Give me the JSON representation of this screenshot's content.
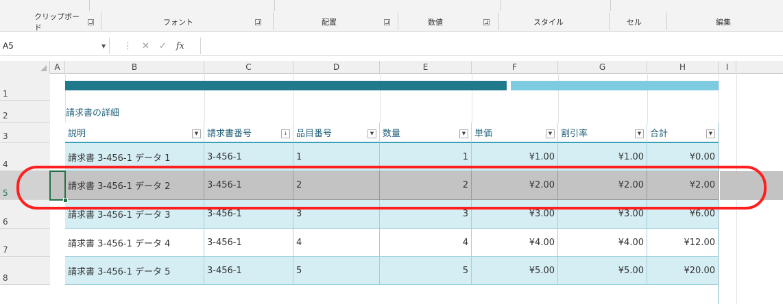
{
  "ribbon": {
    "groups": [
      "クリップボード",
      "フォント",
      "配置",
      "数値",
      "スタイル",
      "セル",
      "編集"
    ]
  },
  "formula_bar": {
    "name_box": "A5",
    "formula": "",
    "fx_label": "fx"
  },
  "columns": [
    "A",
    "B",
    "C",
    "D",
    "E",
    "F",
    "G",
    "H",
    "I"
  ],
  "rows": [
    "1",
    "2",
    "3",
    "4",
    "5",
    "6",
    "7",
    "8"
  ],
  "table": {
    "heading": "請求書の詳細",
    "headers": [
      "説明",
      "請求書番号",
      "品目番号",
      "数量",
      "単価",
      "割引率",
      "合計"
    ],
    "data": [
      [
        "請求書 3-456-1 データ 1",
        "3-456-1",
        "1",
        "1",
        "¥1.00",
        "¥1.00",
        "¥0.00"
      ],
      [
        "請求書 3-456-1 データ 2",
        "3-456-1",
        "2",
        "2",
        "¥2.00",
        "¥2.00",
        "¥2.00"
      ],
      [
        "請求書 3-456-1 データ 3",
        "3-456-1",
        "3",
        "3",
        "¥3.00",
        "¥3.00",
        "¥6.00"
      ],
      [
        "請求書 3-456-1 データ 4",
        "3-456-1",
        "4",
        "4",
        "¥4.00",
        "¥4.00",
        "¥12.00"
      ],
      [
        "請求書 3-456-1 データ 5",
        "3-456-1",
        "5",
        "5",
        "¥5.00",
        "¥5.00",
        "¥20.00"
      ]
    ]
  },
  "colors": {
    "band_dark": "#217a8c",
    "band_light": "#7ccbe0",
    "accent": "#217346",
    "annotation": "#ff1f1f"
  }
}
